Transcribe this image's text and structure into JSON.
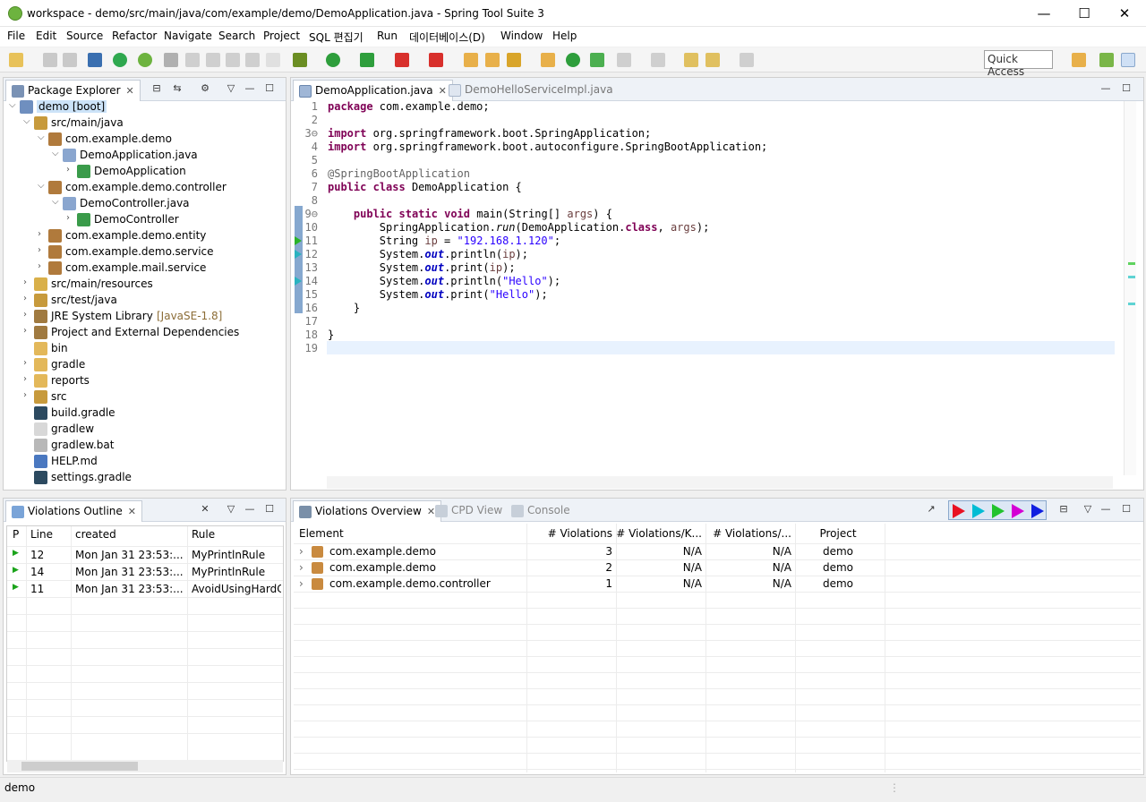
{
  "window": {
    "title": "workspace - demo/src/main/java/com/example/demo/DemoApplication.java - Spring Tool Suite 3",
    "minimize": "—",
    "maximize": "☐",
    "close": "✕"
  },
  "menu": [
    "File",
    "Edit",
    "Source",
    "Refactor",
    "Navigate",
    "Search",
    "Project",
    "SQL 편집기",
    "Run",
    "데이터베이스(D)",
    "Window",
    "Help"
  ],
  "toolbar": {
    "quick_access": "Quick Access"
  },
  "package_explorer": {
    "tab": "Package Explorer",
    "tree": [
      {
        "label": "demo [boot]",
        "twisty": "v",
        "icon": "project-icon",
        "selected": true
      },
      {
        "label": "src/main/java",
        "twisty": "v",
        "icon": "source-folder-icon"
      },
      {
        "label": "com.example.demo",
        "twisty": "v",
        "icon": "package-icon"
      },
      {
        "label": "DemoApplication.java",
        "twisty": "v",
        "icon": "java-file-icon"
      },
      {
        "label": "DemoApplication",
        "twisty": ">",
        "icon": "class-icon"
      },
      {
        "label": "com.example.demo.controller",
        "twisty": "v",
        "icon": "package-icon"
      },
      {
        "label": "DemoController.java",
        "twisty": "v",
        "icon": "java-file-icon"
      },
      {
        "label": "DemoController",
        "twisty": ">",
        "icon": "class-icon"
      },
      {
        "label": "com.example.demo.entity",
        "twisty": ">",
        "icon": "package-icon"
      },
      {
        "label": "com.example.demo.service",
        "twisty": ">",
        "icon": "package-icon"
      },
      {
        "label": "com.example.mail.service",
        "twisty": ">",
        "icon": "package-icon"
      },
      {
        "label": "src/main/resources",
        "twisty": ">",
        "icon": "resource-folder-icon"
      },
      {
        "label": "src/test/java",
        "twisty": ">",
        "icon": "source-folder-icon"
      },
      {
        "label": "JRE System Library",
        "decoration": "[JavaSE-1.8]",
        "twisty": ">",
        "icon": "library-icon"
      },
      {
        "label": "Project and External Dependencies",
        "twisty": ">",
        "icon": "library-icon"
      },
      {
        "label": "bin",
        "twisty": "",
        "icon": "folder-icon"
      },
      {
        "label": "gradle",
        "twisty": ">",
        "icon": "folder-icon"
      },
      {
        "label": "reports",
        "twisty": ">",
        "icon": "folder-icon"
      },
      {
        "label": "src",
        "twisty": ">",
        "icon": "source-folder-icon"
      },
      {
        "label": "build.gradle",
        "twisty": "",
        "icon": "gradle-file-icon"
      },
      {
        "label": "gradlew",
        "twisty": "",
        "icon": "text-file-icon"
      },
      {
        "label": "gradlew.bat",
        "twisty": "",
        "icon": "bat-file-icon"
      },
      {
        "label": "HELP.md",
        "twisty": "",
        "icon": "markdown-file-icon"
      },
      {
        "label": "settings.gradle",
        "twisty": "",
        "icon": "gradle-file-icon"
      }
    ]
  },
  "editor": {
    "tabs": [
      {
        "label": "DemoApplication.java",
        "active": true
      },
      {
        "label": "DemoHelloServiceImpl.java",
        "active": false
      }
    ],
    "lines": [
      {
        "n": "1",
        "code": [
          [
            "kw",
            "package"
          ],
          [
            "p",
            " com.example.demo;"
          ]
        ]
      },
      {
        "n": "2",
        "code": []
      },
      {
        "n": "3⊖",
        "code": [
          [
            "kw",
            "import"
          ],
          [
            "p",
            " org.springframework.boot.SpringApplication;"
          ]
        ]
      },
      {
        "n": "4",
        "code": [
          [
            "kw",
            "import"
          ],
          [
            "p",
            " org.springframework.boot.autoconfigure.SpringBootApplication;"
          ]
        ]
      },
      {
        "n": "5",
        "code": []
      },
      {
        "n": "6",
        "code": [
          [
            "ann",
            "@SpringBootApplication"
          ]
        ]
      },
      {
        "n": "7",
        "code": [
          [
            "kw",
            "public"
          ],
          [
            "p",
            " "
          ],
          [
            "kw",
            "class"
          ],
          [
            "p",
            " DemoApplication {"
          ]
        ]
      },
      {
        "n": "8",
        "code": []
      },
      {
        "n": "9⊖",
        "code": [
          [
            "p",
            "    "
          ],
          [
            "kw",
            "public"
          ],
          [
            "p",
            " "
          ],
          [
            "kw",
            "static"
          ],
          [
            "p",
            " "
          ],
          [
            "kw",
            "void"
          ],
          [
            "p",
            " main(String[] "
          ],
          [
            "param",
            "args"
          ],
          [
            "p",
            ") {"
          ]
        ]
      },
      {
        "n": "10",
        "code": [
          [
            "p",
            "        SpringApplication."
          ],
          [
            "ital",
            "run"
          ],
          [
            "p",
            "(DemoApplication."
          ],
          [
            "kw",
            "class"
          ],
          [
            "p",
            ", "
          ],
          [
            "param",
            "args"
          ],
          [
            "p",
            ");"
          ]
        ]
      },
      {
        "n": "11",
        "code": [
          [
            "p",
            "        String "
          ],
          [
            "param",
            "ip"
          ],
          [
            "p",
            " = "
          ],
          [
            "str",
            "\"192.168.1.120\""
          ],
          [
            "p",
            ";"
          ]
        ]
      },
      {
        "n": "12",
        "code": [
          [
            "p",
            "        System."
          ],
          [
            "fld",
            "out"
          ],
          [
            "p",
            ".println("
          ],
          [
            "param",
            "ip"
          ],
          [
            "p",
            ");"
          ]
        ]
      },
      {
        "n": "13",
        "code": [
          [
            "p",
            "        System."
          ],
          [
            "fld",
            "out"
          ],
          [
            "p",
            ".print("
          ],
          [
            "param",
            "ip"
          ],
          [
            "p",
            ");"
          ]
        ]
      },
      {
        "n": "14",
        "code": [
          [
            "p",
            "        System."
          ],
          [
            "fld",
            "out"
          ],
          [
            "p",
            ".println("
          ],
          [
            "str",
            "\"Hello\""
          ],
          [
            "p",
            ");"
          ]
        ]
      },
      {
        "n": "15",
        "code": [
          [
            "p",
            "        System."
          ],
          [
            "fld",
            "out"
          ],
          [
            "p",
            ".print("
          ],
          [
            "str",
            "\"Hello\""
          ],
          [
            "p",
            ");"
          ]
        ]
      },
      {
        "n": "16",
        "code": [
          [
            "p",
            "    }"
          ]
        ]
      },
      {
        "n": "17",
        "code": []
      },
      {
        "n": "18",
        "code": [
          [
            "p",
            "}"
          ]
        ]
      },
      {
        "n": "19",
        "code": []
      }
    ]
  },
  "violations_outline": {
    "tab": "Violations Outline",
    "columns": [
      "P",
      "Line",
      "created",
      "Rule"
    ],
    "rows": [
      {
        "p": "▶",
        "line": "12",
        "created": "Mon Jan 31 23:53:...",
        "rule": "MyPrintlnRule"
      },
      {
        "p": "▶",
        "line": "14",
        "created": "Mon Jan 31 23:53:...",
        "rule": "MyPrintlnRule"
      },
      {
        "p": "▶",
        "line": "11",
        "created": "Mon Jan 31 23:53:...",
        "rule": "AvoidUsingHardCo"
      }
    ]
  },
  "violations_overview": {
    "tabs": [
      "Violations Overview",
      "CPD View",
      "Console"
    ],
    "columns": [
      "Element",
      "# Violations",
      "# Violations/K...",
      "# Violations/...",
      "Project"
    ],
    "rows": [
      {
        "element": "com.example.demo",
        "violations": "3",
        "per_kloc": "N/A",
        "per_method": "N/A",
        "project": "demo"
      },
      {
        "element": "com.example.demo",
        "violations": "2",
        "per_kloc": "N/A",
        "per_method": "N/A",
        "project": "demo"
      },
      {
        "element": "com.example.demo.controller",
        "violations": "1",
        "per_kloc": "N/A",
        "per_method": "N/A",
        "project": "demo"
      }
    ],
    "priority_colors": [
      "#e81123",
      "#00bcd4",
      "#22c32e",
      "#d400d4",
      "#1020e0"
    ]
  },
  "status": {
    "text": "demo"
  }
}
